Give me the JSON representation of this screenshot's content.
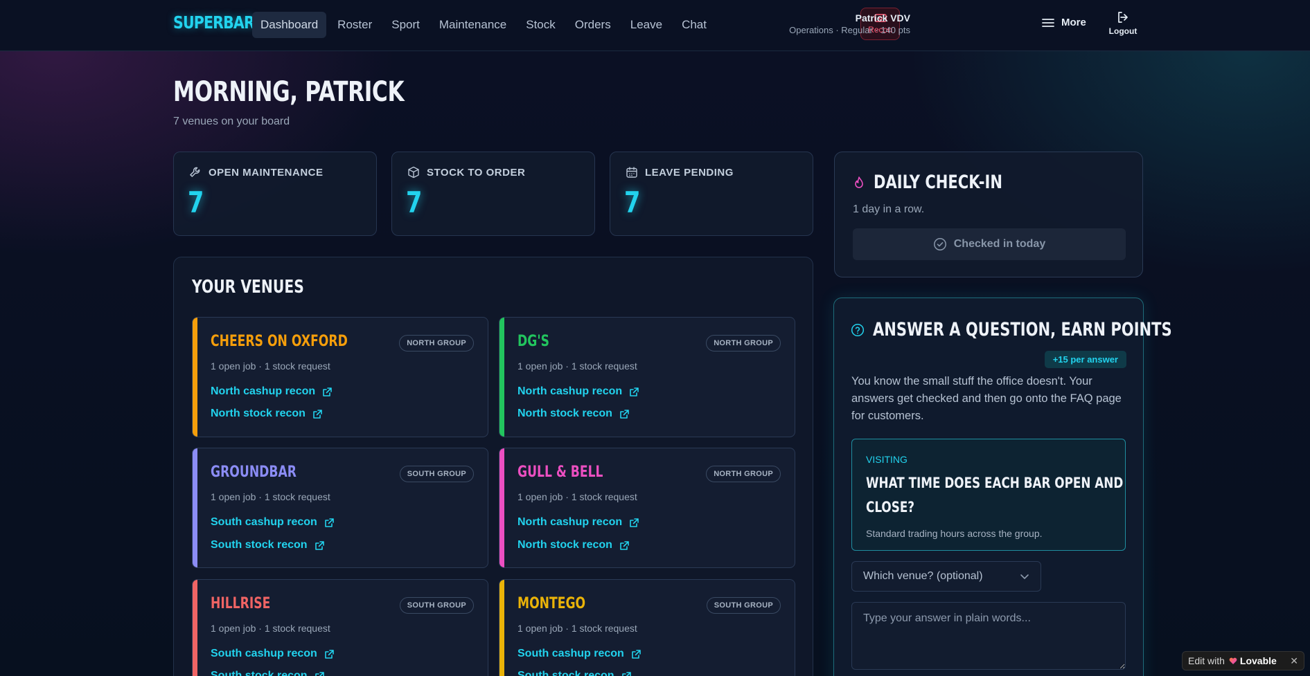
{
  "app": {
    "logo": "SUPERBAR"
  },
  "nav": {
    "links": [
      "Dashboard",
      "Roster",
      "Sport",
      "Maintenance",
      "Stock",
      "Orders",
      "Leave",
      "Chat"
    ],
    "active": "Dashboard",
    "recon_label": "Recon",
    "user_name": "Patrick VDV",
    "user_meta": "Operations · Regular · 140 pts",
    "more_label": "More",
    "logout_label": "Logout"
  },
  "greeting": {
    "title": "MORNING, PATRICK",
    "subtitle": "7 venues on your board"
  },
  "stats": [
    {
      "label": "OPEN MAINTENANCE",
      "value": "7",
      "icon": "wrench-icon"
    },
    {
      "label": "STOCK TO ORDER",
      "value": "7",
      "icon": "box-icon"
    },
    {
      "label": "LEAVE PENDING",
      "value": "7",
      "icon": "calendar-icon"
    }
  ],
  "venues": {
    "title": "YOUR VENUES",
    "items": [
      {
        "name": "CHEERS ON OXFORD",
        "group": "NORTH GROUP",
        "summary": "1 open job · 1 stock request",
        "links": [
          "North cashup recon",
          "North stock recon"
        ],
        "color": "#f59e0b"
      },
      {
        "name": "DG'S",
        "group": "NORTH GROUP",
        "summary": "1 open job · 1 stock request",
        "links": [
          "North cashup recon",
          "North stock recon"
        ],
        "color": "#22c55e"
      },
      {
        "name": "GROUNDBAR",
        "group": "SOUTH GROUP",
        "summary": "1 open job · 1 stock request",
        "links": [
          "South cashup recon",
          "South stock recon"
        ],
        "color": "#8b8cf5"
      },
      {
        "name": "GULL & BELL",
        "group": "NORTH GROUP",
        "summary": "1 open job · 1 stock request",
        "links": [
          "North cashup recon",
          "North stock recon"
        ],
        "color": "#ec4fc1"
      },
      {
        "name": "HILLRISE",
        "group": "SOUTH GROUP",
        "summary": "1 open job · 1 stock request",
        "links": [
          "South cashup recon",
          "South stock recon"
        ],
        "color": "#f06464"
      },
      {
        "name": "MONTEGO",
        "group": "SOUTH GROUP",
        "summary": "1 open job · 1 stock request",
        "links": [
          "South cashup recon",
          "South stock recon"
        ],
        "color": "#eab308"
      }
    ]
  },
  "checkin": {
    "title": "DAILY CHECK-IN",
    "streak": "1 day in a row.",
    "button_label": "Checked in today"
  },
  "question": {
    "title": "ANSWER A QUESTION, EARN POINTS",
    "points_badge": "+15 per answer",
    "description": "You know the small stuff the office doesn't. Your answers get checked and then go onto the FAQ page for customers.",
    "category": "VISITING",
    "question_line1": "WHAT TIME DOES EACH BAR OPEN AND",
    "question_line2": "CLOSE?",
    "hint": "Standard trading hours across the group.",
    "venue_select": "Which venue? (optional)",
    "answer_placeholder": "Type your answer in plain words..."
  },
  "badge": {
    "edit_with": "Edit with",
    "brand": "Lovable"
  }
}
